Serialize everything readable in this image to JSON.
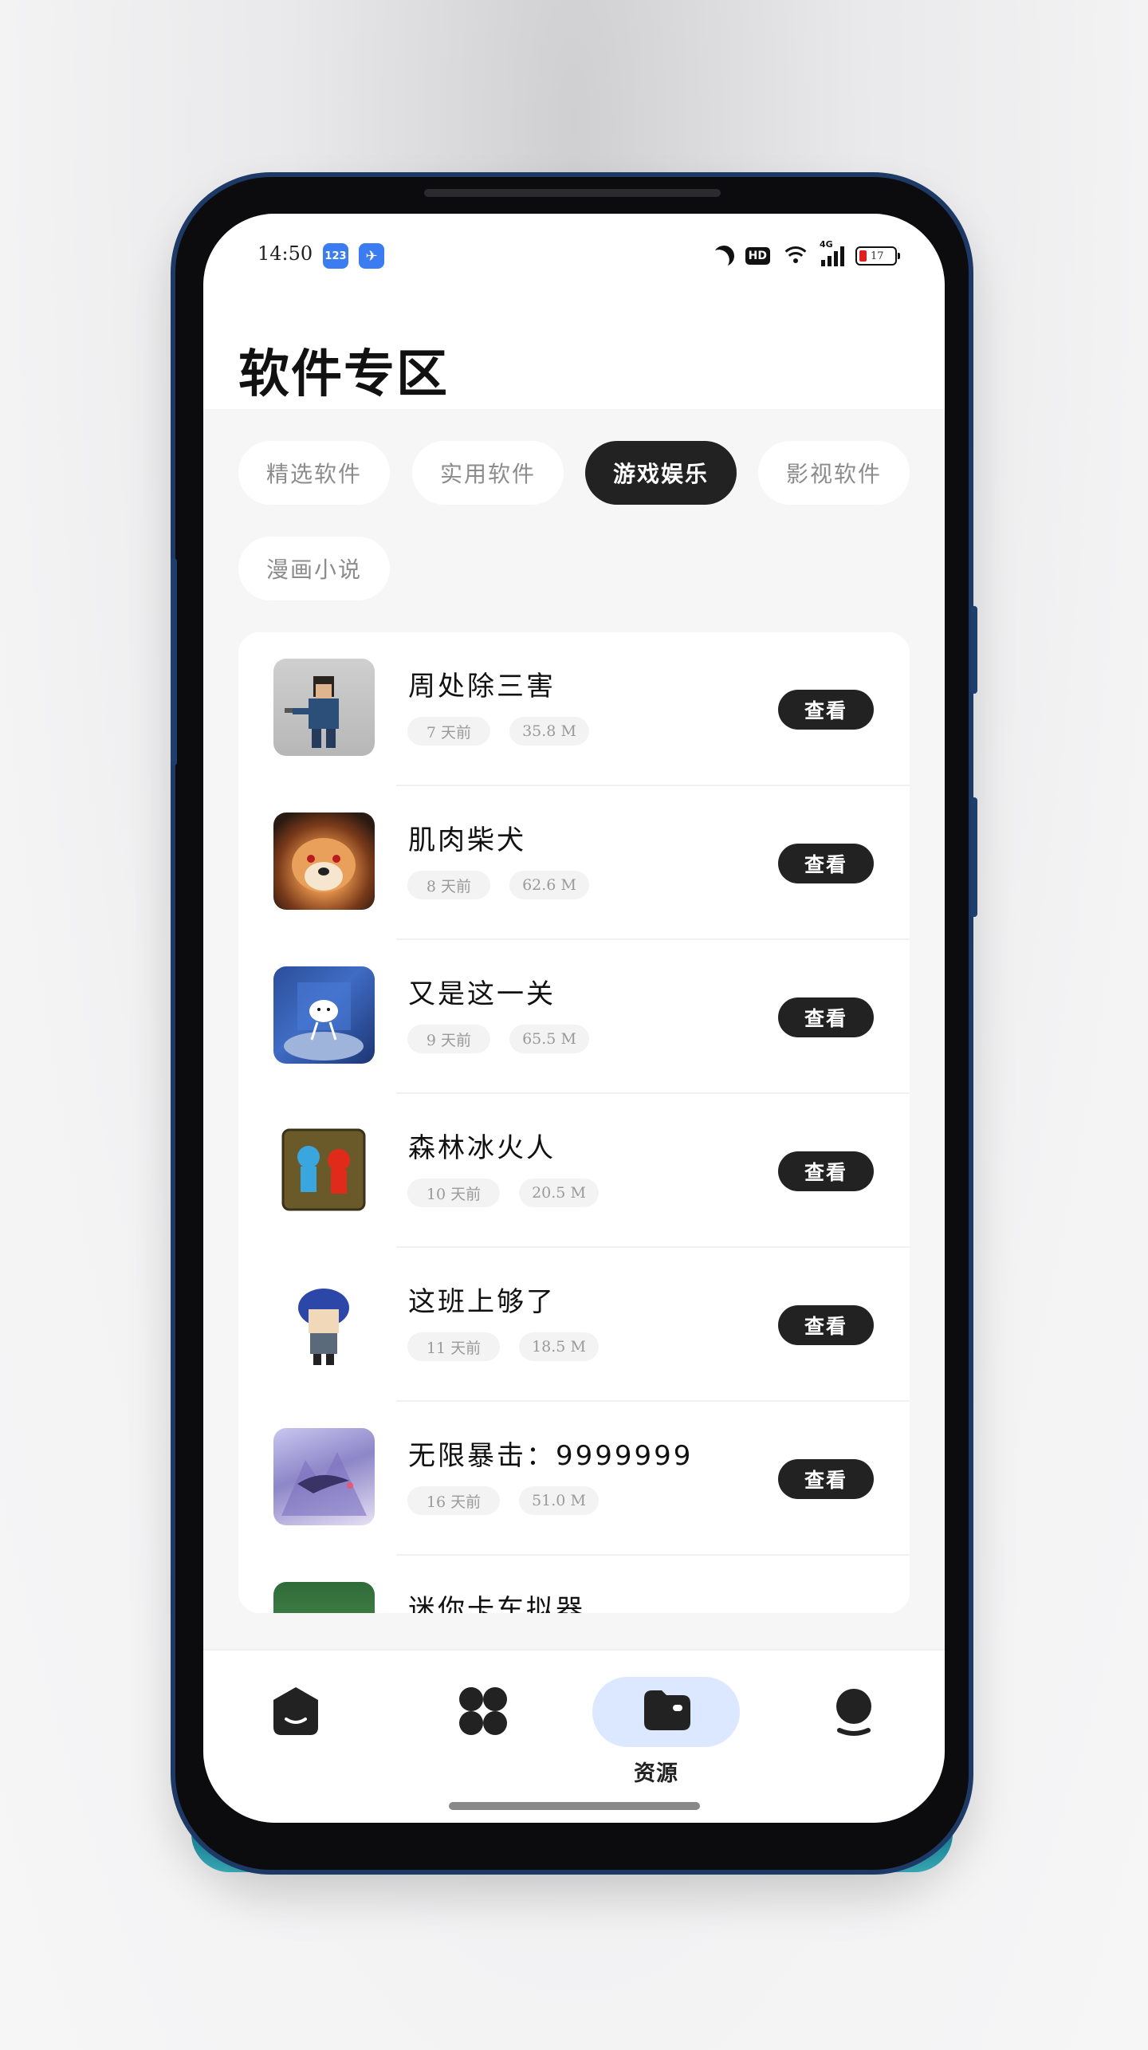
{
  "status_bar": {
    "time": "14:50",
    "app_icons": [
      "123",
      "✈"
    ],
    "battery": "17"
  },
  "header": {
    "title": "软件专区"
  },
  "categories": [
    {
      "label": "精选软件",
      "active": false
    },
    {
      "label": "实用软件",
      "active": false
    },
    {
      "label": "游戏娱乐",
      "active": true
    },
    {
      "label": "影视软件",
      "active": false
    },
    {
      "label": "漫画小说",
      "active": false
    }
  ],
  "apps": [
    {
      "name": "周处除三害",
      "age": "7 天前",
      "size": "35.8 M",
      "button": "查看"
    },
    {
      "name": "肌肉柴犬",
      "age": "8 天前",
      "size": "62.6 M",
      "button": "查看"
    },
    {
      "name": "又是这一关",
      "age": "9 天前",
      "size": "65.5 M",
      "button": "查看"
    },
    {
      "name": "森林冰火人",
      "age": "10 天前",
      "size": "20.5 M",
      "button": "查看"
    },
    {
      "name": "这班上够了",
      "age": "11 天前",
      "size": "18.5 M",
      "button": "查看"
    },
    {
      "name": "无限暴击：9999999",
      "age": "16 天前",
      "size": "51.0 M",
      "button": "查看"
    },
    {
      "name": "迷你卡车拟器",
      "age": "",
      "size": "",
      "button": ""
    }
  ],
  "bottom_nav": {
    "items": [
      "home-icon",
      "apps-icon",
      "folder-icon",
      "profile-icon"
    ],
    "active_label": "资源"
  },
  "colors": {
    "accent_pill": "#dbe8ff",
    "dark": "#222222"
  }
}
